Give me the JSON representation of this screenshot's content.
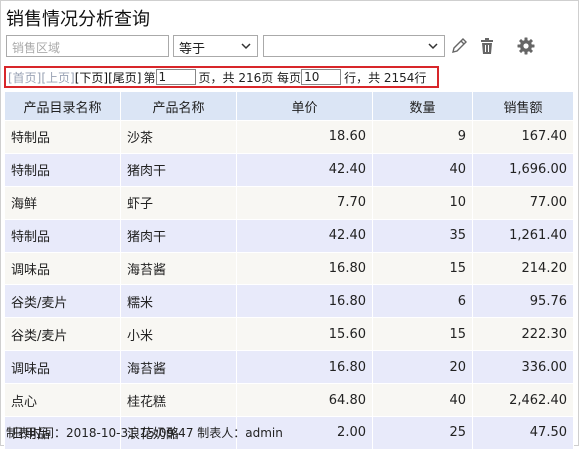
{
  "title": "销售情况分析查询",
  "filter": {
    "field_placeholder": "销售区域",
    "operator": "等于",
    "value": ""
  },
  "icons": {
    "edit": "pencil-icon",
    "delete": "trash-icon",
    "settings": "gear-icon"
  },
  "pager": {
    "first": "[首页]",
    "prev": "[上页]",
    "next": "[下页]",
    "last": "[尾页]",
    "page_prefix": "第",
    "current_page": "1",
    "page_suffix": "页，共 216页 每页",
    "per_page": "10",
    "rows_suffix": "行，共 2154行"
  },
  "table": {
    "headers": [
      "产品目录名称",
      "产品名称",
      "单价",
      "数量",
      "销售额"
    ],
    "rows": [
      [
        "特制品",
        "沙茶",
        "18.60",
        "9",
        "167.40"
      ],
      [
        "特制品",
        "猪肉干",
        "42.40",
        "40",
        "1,696.00"
      ],
      [
        "海鲜",
        "虾子",
        "7.70",
        "10",
        "77.00"
      ],
      [
        "特制品",
        "猪肉干",
        "42.40",
        "35",
        "1,261.40"
      ],
      [
        "调味品",
        "海苔酱",
        "16.80",
        "15",
        "214.20"
      ],
      [
        "谷类/麦片",
        "糯米",
        "16.80",
        "6",
        "95.76"
      ],
      [
        "谷类/麦片",
        "小米",
        "15.60",
        "15",
        "222.30"
      ],
      [
        "调味品",
        "海苔酱",
        "16.80",
        "20",
        "336.00"
      ],
      [
        "点心",
        "桂花糕",
        "64.80",
        "40",
        "2,462.40"
      ],
      [
        "日用品",
        "浪花奶酪",
        "2.00",
        "25",
        "47.50"
      ]
    ]
  },
  "footer": "制表时间：2018-10-31 15:09:47 制表人：admin"
}
